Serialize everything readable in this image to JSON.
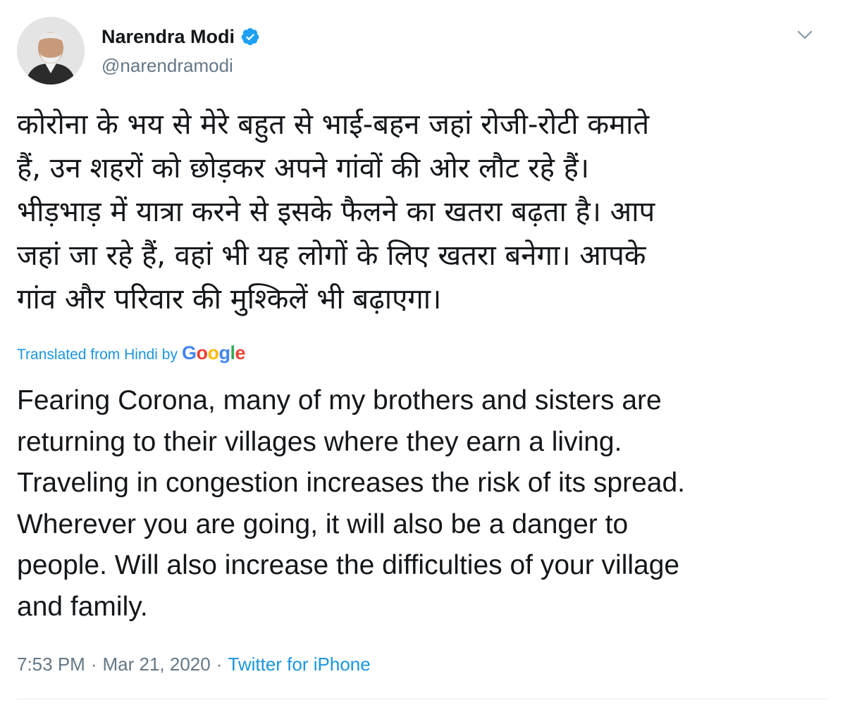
{
  "author": {
    "display_name": "Narendra Modi",
    "handle": "@narendramodi",
    "verified": true
  },
  "tweet": {
    "hindi_lines": [
      "कोरोना के भय से मेरे बहुत से भाई-बहन जहां रोजी-रोटी कमाते",
      "हैं, उन शहरों को छोड़कर अपने गांवों की ओर लौट रहे हैं।",
      "भीड़भाड़ में यात्रा करने से इसके फैलने का खतरा बढ़ता है। आप",
      "जहां जा रहे हैं, वहां भी यह लोगों के लिए खतरा बनेगा। आपके",
      "गांव और परिवार की मुश्किलें भी बढ़ाएगा।"
    ],
    "translation_label": "Translated from Hindi by",
    "translation_provider": "Google",
    "english_lines": [
      "Fearing Corona, many of my brothers and sisters are",
      "returning to their villages where they earn a living.",
      "Traveling in congestion increases the risk of its spread.",
      "Wherever you are going, it will also be a danger to",
      "people. Will also increase the difficulties of your village",
      "and family."
    ],
    "time": "7:53 PM",
    "separator": "·",
    "date": "Mar 21, 2020",
    "source": "Twitter for iPhone"
  },
  "icons": {
    "verified": "verified-badge-icon",
    "menu": "chevron-down-icon"
  },
  "colors": {
    "link": "#1b95e0",
    "muted": "#657786",
    "verified": "#1da1f2",
    "google_blue": "#4285f4",
    "google_red": "#ea4335",
    "google_yellow": "#fbbc05",
    "google_green": "#34a853"
  }
}
